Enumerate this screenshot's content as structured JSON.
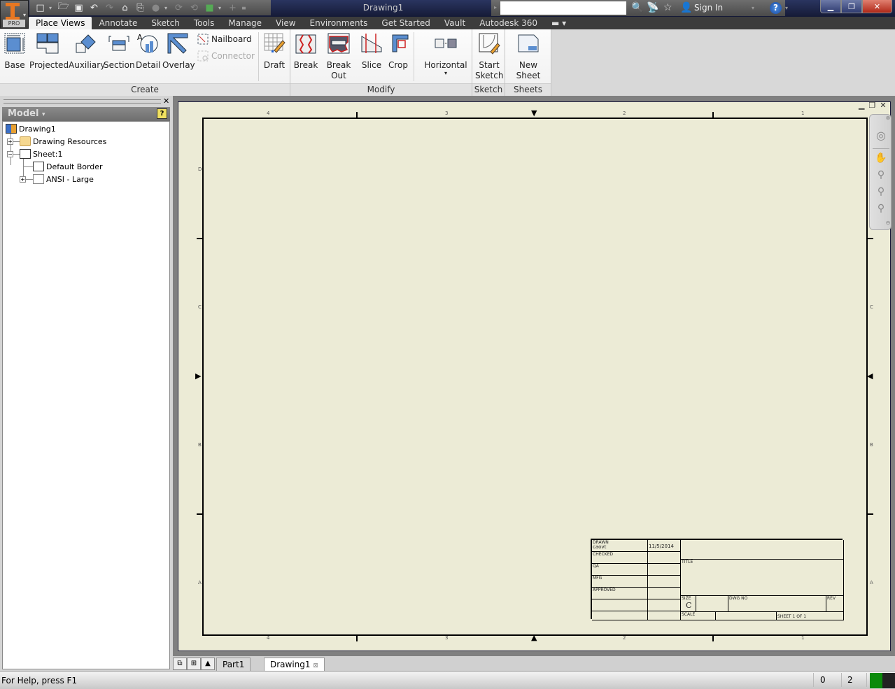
{
  "window": {
    "title": "Drawing1",
    "edition_badge": "PRO",
    "controls": [
      "minimize",
      "restore",
      "close"
    ]
  },
  "quick_access": {
    "buttons": [
      {
        "name": "new-icon",
        "glyph": "🗋"
      },
      {
        "name": "open-icon",
        "glyph": "📂"
      },
      {
        "name": "save-icon",
        "glyph": "💾"
      },
      {
        "name": "undo-icon",
        "glyph": "↶"
      },
      {
        "name": "redo-icon",
        "glyph": "↷"
      },
      {
        "name": "home-icon",
        "glyph": "⌂"
      },
      {
        "name": "print-icon",
        "glyph": "🖶"
      },
      {
        "name": "select-icon",
        "glyph": "●"
      },
      {
        "name": "update-icon",
        "glyph": "⟳"
      },
      {
        "name": "update-all-icon",
        "glyph": "⟲"
      },
      {
        "name": "appearance-icon",
        "glyph": "■"
      },
      {
        "name": "add-icon",
        "glyph": "+"
      },
      {
        "name": "customize-icon",
        "glyph": "≡"
      }
    ]
  },
  "search": {
    "value": "",
    "placeholder": ""
  },
  "infocenter": {
    "sign_in_label": "Sign In",
    "help_glyph": "?"
  },
  "ribbon_tabs": [
    {
      "label": "Place Views",
      "active": true
    },
    {
      "label": "Annotate"
    },
    {
      "label": "Sketch"
    },
    {
      "label": "Tools"
    },
    {
      "label": "Manage"
    },
    {
      "label": "View"
    },
    {
      "label": "Environments"
    },
    {
      "label": "Get Started"
    },
    {
      "label": "Vault"
    },
    {
      "label": "Autodesk 360"
    }
  ],
  "ribbon": {
    "create": {
      "label": "Create",
      "buttons": [
        "Base",
        "Projected",
        "Auxiliary",
        "Section",
        "Detail",
        "Overlay"
      ],
      "small_buttons": [
        {
          "label": "Nailboard",
          "enabled": true
        },
        {
          "label": "Connector",
          "enabled": false
        }
      ],
      "draft": "Draft"
    },
    "modify": {
      "label": "Modify",
      "buttons": [
        "Break",
        "Break Out",
        "Slice",
        "Crop"
      ],
      "dropdown": "Horizontal"
    },
    "sketch": {
      "label": "Sketch",
      "button_line1": "Start",
      "button_line2": "Sketch"
    },
    "sheets": {
      "label": "Sheets",
      "button": "New Sheet"
    }
  },
  "browser": {
    "header": "Model",
    "help_glyph": "?",
    "tree": [
      {
        "label": "Drawing1",
        "level": 0
      },
      {
        "label": "Drawing Resources",
        "level": 1,
        "expander": "+"
      },
      {
        "label": "Sheet:1",
        "level": 1,
        "expander": "−"
      },
      {
        "label": "Default Border",
        "level": 2
      },
      {
        "label": "ANSI - Large",
        "level": 2,
        "expander": "+"
      }
    ]
  },
  "sheet": {
    "zone_columns": [
      "4",
      "3",
      "2",
      "1"
    ],
    "zone_rows": [
      "D",
      "C",
      "B",
      "A"
    ],
    "title_block": {
      "drawn_label": "DRAWN",
      "drawn_by": "caovt",
      "drawn_date": "11/5/2014",
      "checked_label": "CHECKED",
      "qa_label": "QA",
      "mfg_label": "MFG",
      "approved_label": "APPROVED",
      "title_label": "TITLE",
      "size_label": "SIZE",
      "size_value": "C",
      "dwg_no_label": "DWG NO",
      "rev_label": "REV",
      "scale_label": "SCALE",
      "sheet_label": "SHEET 1  OF 1"
    }
  },
  "nav_bar": [
    "steering-wheel-2d-icon",
    "pan-icon",
    "zoom-icon",
    "zoom-all-icon",
    "zoom-window-icon"
  ],
  "document_tabs": [
    {
      "label": "Part1",
      "active": false
    },
    {
      "label": "Drawing1",
      "active": true
    }
  ],
  "status": {
    "help_text": "For Help, press F1",
    "field1": "0",
    "field2": "2"
  }
}
